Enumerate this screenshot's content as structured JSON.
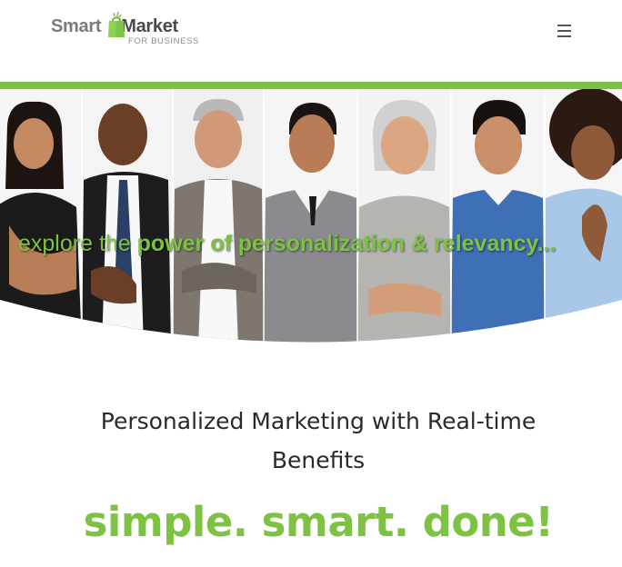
{
  "header": {
    "logo": {
      "word1": "Smart",
      "word2": "Market",
      "sub": "FOR BUSINESS"
    },
    "menu_icon": "hamburger-icon"
  },
  "colors": {
    "accent": "#7dc242",
    "text_dark": "#2a2a2a",
    "logo_gray": "#7b7b7b"
  },
  "hero": {
    "tagline_light": "explore the",
    "tagline_bold": "power of personalization & relevancy..."
  },
  "content": {
    "headline": "Personalized Marketing with Real-time Benefits",
    "slogan": "simple. smart. done!"
  }
}
